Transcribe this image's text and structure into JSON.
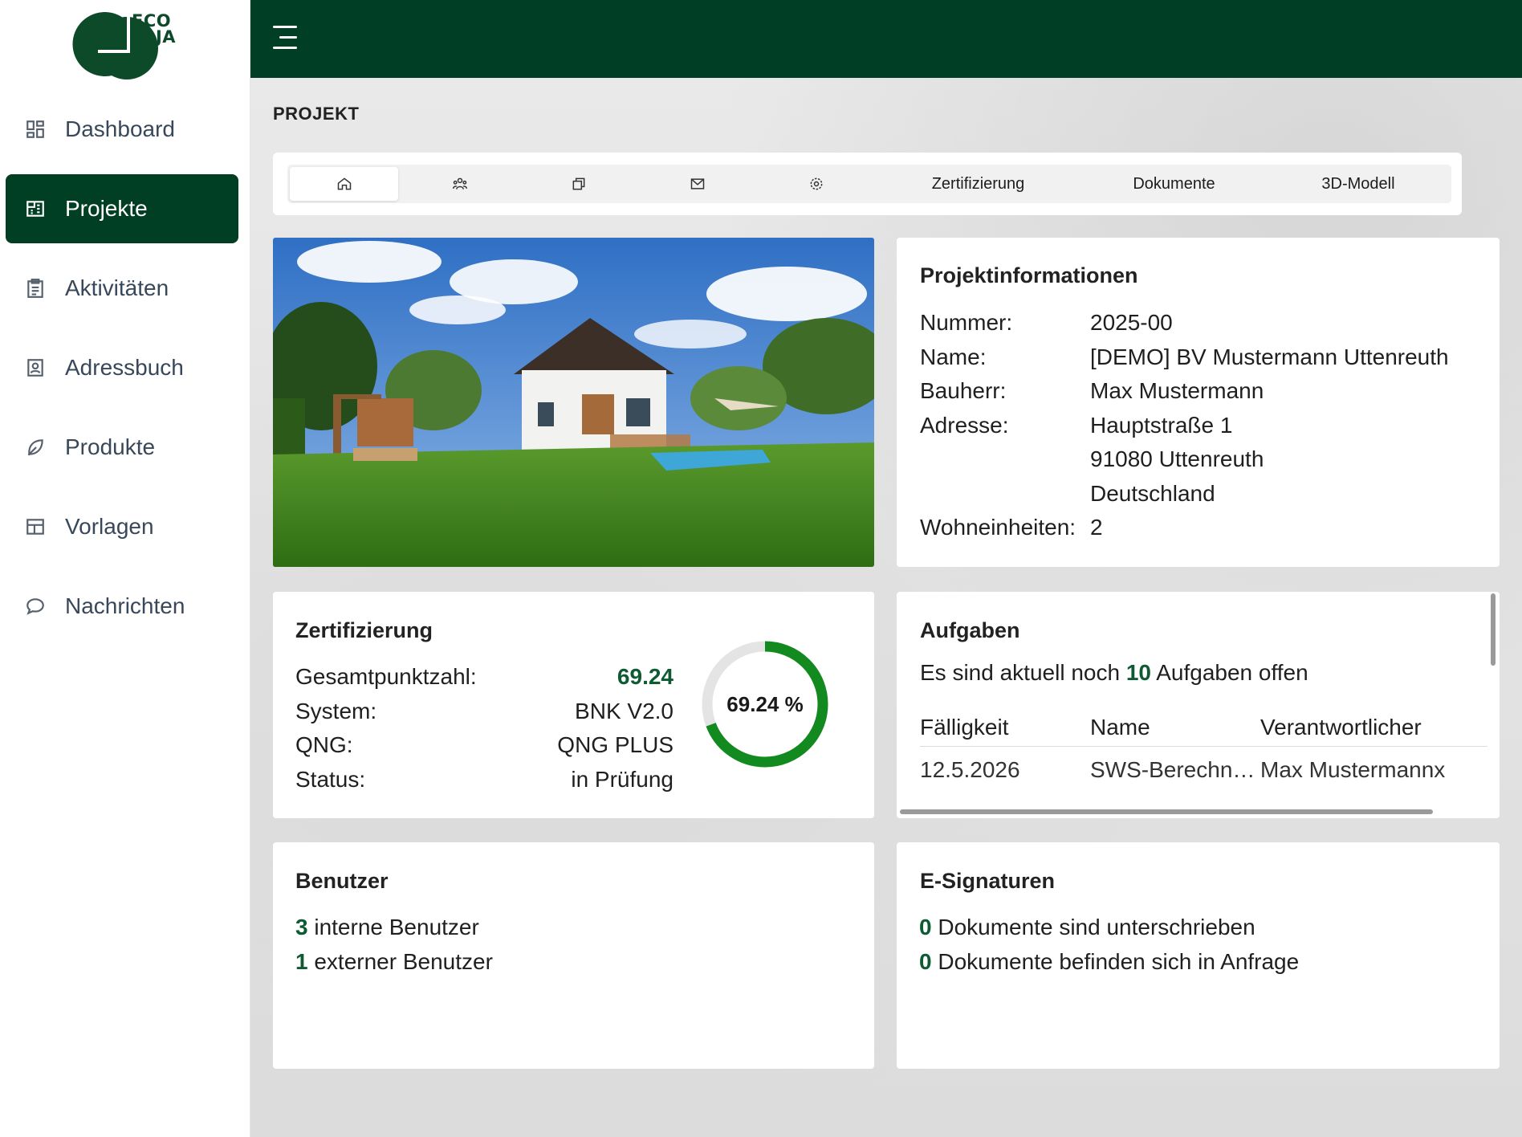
{
  "logo": {
    "text_line1": "ECO",
    "text_line2": "TAJA"
  },
  "sidebar": {
    "items": [
      {
        "label": "Dashboard",
        "icon": "dashboard-icon"
      },
      {
        "label": "Projekte",
        "icon": "building-icon",
        "active": true
      },
      {
        "label": "Aktivitäten",
        "icon": "clipboard-icon"
      },
      {
        "label": "Adressbuch",
        "icon": "contact-book-icon"
      },
      {
        "label": "Produkte",
        "icon": "leaf-icon"
      },
      {
        "label": "Vorlagen",
        "icon": "layout-grid-icon"
      },
      {
        "label": "Nachrichten",
        "icon": "chat-bubble-icon"
      }
    ]
  },
  "colors": {
    "brand_dark_green": "#003f25",
    "accent_green": "#0e5a32",
    "donut_green": "#138a1f"
  },
  "page": {
    "title": "PROJEKT"
  },
  "tabs": [
    {
      "icon": "home-icon",
      "active": true
    },
    {
      "icon": "users-icon"
    },
    {
      "icon": "copy-icon"
    },
    {
      "icon": "mail-icon"
    },
    {
      "icon": "settings-icon"
    },
    {
      "label": "Zertifizierung"
    },
    {
      "label": "Dokumente"
    },
    {
      "label": "3D-Modell"
    }
  ],
  "project_info": {
    "title": "Projektinformationen",
    "nummer_label": "Nummer:",
    "nummer": "2025-00",
    "name_label": "Name:",
    "name": "[DEMO] BV Mustermann Uttenreuth",
    "bauherr_label": "Bauherr:",
    "bauherr": "Max Mustermann",
    "adresse_label": "Adresse:",
    "strasse": "Hauptstraße 1",
    "ort": "91080 Uttenreuth",
    "land": "Deutschland",
    "wohneinheiten_label": "Wohneinheiten:",
    "wohneinheiten": "2"
  },
  "certification": {
    "title": "Zertifizierung",
    "gesamt_label": "Gesamtpunktzahl:",
    "gesamt": "69.24",
    "system_label": "System:",
    "system": "BNK V2.0",
    "qng_label": "QNG:",
    "qng": "QNG PLUS",
    "status_label": "Status:",
    "status": "in Prüfung",
    "donut_text": "69.24 %",
    "donut_fraction": 0.6924
  },
  "tasks": {
    "title": "Aufgaben",
    "summary_prefix": "Es sind aktuell noch",
    "open_count": "10",
    "summary_suffix": "Aufgaben offen",
    "columns": [
      "Fälligkeit",
      "Name",
      "Verantwortlicher"
    ],
    "rows": [
      {
        "due": "12.5.2026",
        "name": "SWS-Berechnu…",
        "owner": "Max Mustermannx"
      }
    ]
  },
  "users": {
    "title": "Benutzer",
    "internal_count": "3",
    "internal_label": "interne Benutzer",
    "external_count": "1",
    "external_label": "externer Benutzer"
  },
  "esignatures": {
    "title": "E-Signaturen",
    "signed_count": "0",
    "signed_label": "Dokumente sind unterschrieben",
    "pending_count": "0",
    "pending_label": "Dokumente befinden sich in Anfrage"
  }
}
